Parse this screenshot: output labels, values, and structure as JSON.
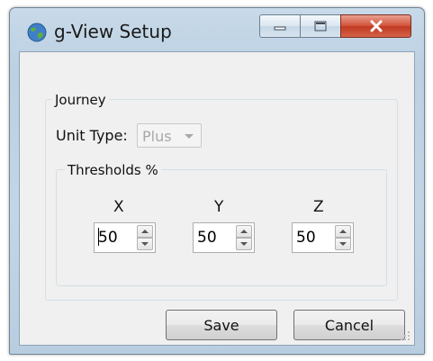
{
  "window": {
    "title": "g-View Setup"
  },
  "journey_group": {
    "label": "Journey",
    "unit_type_label": "Unit Type:",
    "unit_type_value": "Plus"
  },
  "thresholds_group": {
    "label": "Thresholds %",
    "fields": [
      {
        "axis": "X",
        "value": "50"
      },
      {
        "axis": "Y",
        "value": "50"
      },
      {
        "axis": "Z",
        "value": "50"
      }
    ]
  },
  "buttons": {
    "save": "Save",
    "cancel": "Cancel"
  },
  "icons": {
    "app": "globe-icon",
    "minimize": "minimize-icon",
    "maximize": "maximize-icon",
    "close": "close-icon",
    "resize": "resize-grip-icon"
  },
  "colors": {
    "close_button": "#c8432a",
    "client_background": "#f0f0f0",
    "disabled_text": "#a8a8a8"
  }
}
